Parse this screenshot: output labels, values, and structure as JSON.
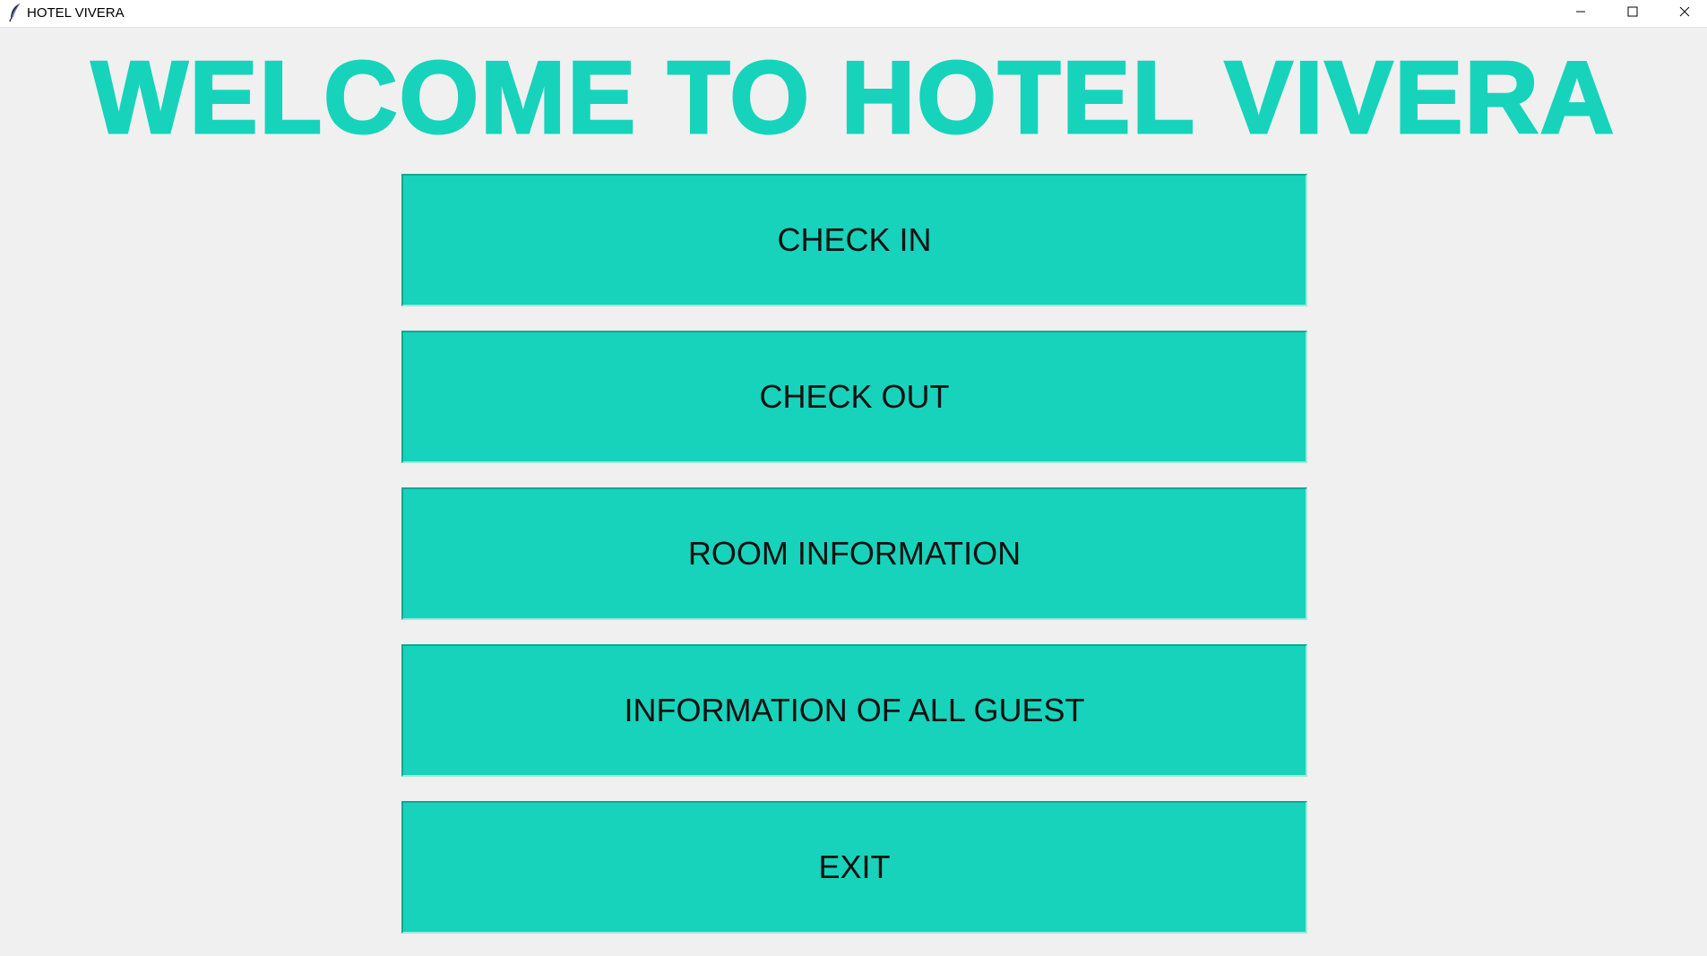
{
  "window": {
    "title": "HOTEL VIVERA",
    "app_icon": "feather-icon",
    "controls": {
      "minimize_icon": "minimize-icon",
      "maximize_icon": "maximize-icon",
      "close_icon": "close-icon"
    }
  },
  "main": {
    "heading": "WELCOME TO HOTEL VIVERA",
    "buttons": [
      {
        "label": "CHECK IN"
      },
      {
        "label": "CHECK OUT"
      },
      {
        "label": "ROOM INFORMATION"
      },
      {
        "label": "INFORMATION OF ALL GUEST"
      },
      {
        "label": "EXIT"
      }
    ]
  },
  "colors": {
    "accent": "#17d3bb",
    "background": "#f0f0f0",
    "button_text": "#111111"
  }
}
